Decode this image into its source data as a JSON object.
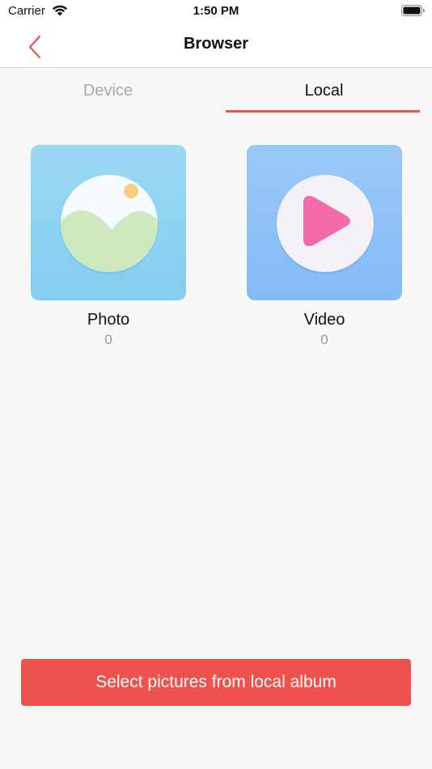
{
  "status_bar": {
    "carrier": "Carrier",
    "time": "1:50 PM",
    "wifi_icon": "wifi-icon",
    "battery_icon": "battery-icon"
  },
  "nav": {
    "title": "Browser",
    "back_icon": "chevron-left-icon"
  },
  "tabs": [
    {
      "label": "Device",
      "active": false
    },
    {
      "label": "Local",
      "active": true
    }
  ],
  "tiles": [
    {
      "label": "Photo",
      "count": "0",
      "icon": "photo-icon"
    },
    {
      "label": "Video",
      "count": "0",
      "icon": "video-play-icon"
    }
  ],
  "select_button": {
    "label": "Select pictures from local album"
  },
  "colors": {
    "accent": "#ef524c",
    "tab_inactive": "#a8a8a8",
    "photo_tile": "#92d5f2",
    "video_tile": "#92c2f9"
  }
}
